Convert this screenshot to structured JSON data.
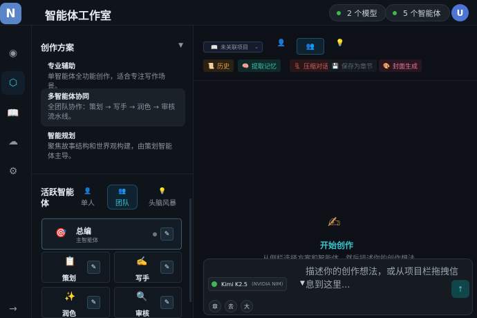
{
  "app": {
    "logo_letter": "N",
    "title": "智能体工作室"
  },
  "header": {
    "model_count": "2 个模型",
    "agent_count": "5 个智能体",
    "user_initial": "U",
    "status_color": "#3fb950"
  },
  "rail": {
    "items": [
      {
        "icon": "target-icon",
        "active": false
      },
      {
        "icon": "hexagon-icon",
        "active": true
      },
      {
        "icon": "book-icon",
        "active": false
      },
      {
        "icon": "cloud-icon",
        "active": false
      },
      {
        "icon": "gear-icon",
        "active": false
      },
      {
        "icon": "logout-arrow-icon",
        "active": false
      }
    ]
  },
  "plans": {
    "title": "创作方案",
    "items": [
      {
        "title": "专业辅助",
        "desc": "单智能体全功能创作，适合专注写作场景。",
        "active": false
      },
      {
        "title": "多智能体协同",
        "desc": "全团队协作：策划 → 写手 → 润色 → 审核流水线。",
        "active": true
      },
      {
        "title": "智能规划",
        "desc": "聚焦故事结构和世界观构建，由策划智能体主导。",
        "active": false
      }
    ]
  },
  "agents": {
    "title": "活跃智能体",
    "modes": [
      {
        "label": "单人",
        "icon": "person-icon",
        "active": false
      },
      {
        "label": "团队",
        "icon": "team-icon",
        "active": true
      },
      {
        "label": "头脑风暴",
        "icon": "lightbulb-icon",
        "active": false
      }
    ],
    "lead": {
      "name": "总编",
      "role": "主智能体",
      "emoji": "🎯"
    },
    "members": [
      {
        "name": "策划",
        "emoji": "📋"
      },
      {
        "name": "写手",
        "emoji": "✍️"
      },
      {
        "name": "润色",
        "emoji": "✨"
      },
      {
        "name": "审核",
        "emoji": "🔍"
      }
    ]
  },
  "toolbar": {
    "project_select": "未关联项目",
    "tags": [
      {
        "label": "历史",
        "icon": "scroll-icon",
        "color": "#e0a24a",
        "bg": "#2b2113"
      },
      {
        "label": "提取记忆",
        "icon": "brain-icon",
        "color": "#3fc1b0",
        "bg": "#0f2a28"
      },
      {
        "label": "压缩对话",
        "icon": "compress-icon",
        "color": "#c76464",
        "bg": "#2a1616"
      },
      {
        "label": "保存为章节",
        "icon": "save-icon",
        "color": "#5c6670",
        "bg": "#161b22"
      },
      {
        "label": "封面生成",
        "icon": "palette-icon",
        "color": "#e07a9a",
        "bg": "#2a1620"
      }
    ]
  },
  "main": {
    "empty_title": "开始创作",
    "empty_desc": "从侧栏选择方案和智能体，然后描述你的创作想法"
  },
  "composer": {
    "placeholder": "描述你的创作想法，或从项目栏拖拽信息到这里...",
    "model_name": "Kimi K2.5",
    "model_provider": "(NVIDIA NIM)",
    "format_buttons": [
      "章",
      "去",
      "大"
    ]
  }
}
